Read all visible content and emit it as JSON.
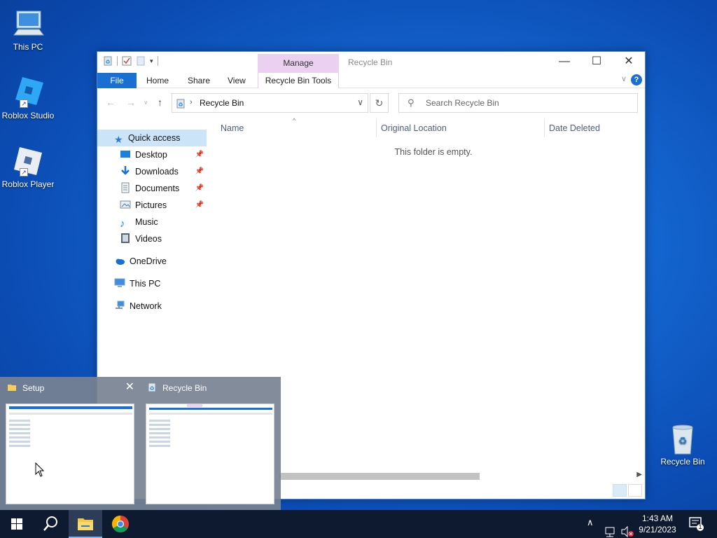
{
  "desktop": {
    "icons": [
      {
        "label": "This PC"
      },
      {
        "label": "Roblox Studio"
      },
      {
        "label": "Roblox Player"
      },
      {
        "label": "Recycle Bin"
      }
    ]
  },
  "window": {
    "title": "Recycle Bin",
    "context_group": "Manage",
    "tabs": {
      "file": "File",
      "home": "Home",
      "share": "Share",
      "view": "View",
      "context": "Recycle Bin Tools"
    },
    "address": {
      "path": "Recycle Bin"
    },
    "search": {
      "placeholder": "Search Recycle Bin"
    },
    "nav": {
      "quick_access": "Quick access",
      "desktop": "Desktop",
      "downloads": "Downloads",
      "documents": "Documents",
      "pictures": "Pictures",
      "music": "Music",
      "videos": "Videos",
      "onedrive": "OneDrive",
      "this_pc": "This PC",
      "network": "Network"
    },
    "columns": {
      "name": "Name",
      "original_location": "Original Location",
      "date_deleted": "Date Deleted"
    },
    "empty_message": "This folder is empty."
  },
  "preview": {
    "items": [
      {
        "title": "Setup"
      },
      {
        "title": "Recycle Bin"
      }
    ]
  },
  "taskbar": {
    "clock": {
      "time": "1:43 AM",
      "date": "9/21/2023"
    },
    "notification_count": "1"
  },
  "colors": {
    "accent": "#1a6fd3",
    "context_tab": "#ecd0f2",
    "taskbar": "#0e1a2f"
  }
}
